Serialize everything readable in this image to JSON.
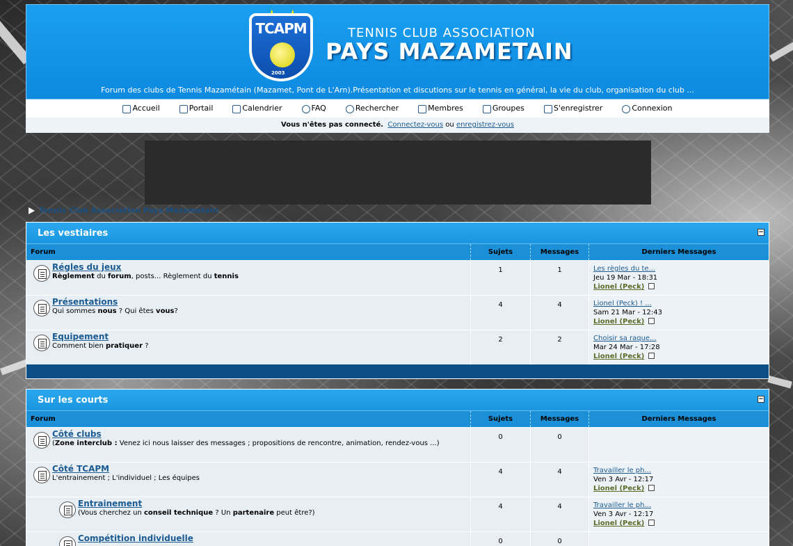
{
  "header": {
    "logo_text": "TCAPM",
    "logo_year": "2003",
    "site_sub": "TENNIS CLUB ASSOCIATION",
    "site_main": "PAYS MAZAMETAIN",
    "description": "Forum des clubs de Tennis Mazamétain (Mazamet, Pont de L'Arn).Présentation et discutions sur le tennis en général, la vie du club, organisation du club ..."
  },
  "nav": {
    "items": [
      {
        "label": "Accueil",
        "icon": "home-icon"
      },
      {
        "label": "Portail",
        "icon": "portal-icon"
      },
      {
        "label": "Calendrier",
        "icon": "calendar-icon"
      },
      {
        "label": "FAQ",
        "icon": "help-icon"
      },
      {
        "label": "Rechercher",
        "icon": "search-icon"
      },
      {
        "label": "Membres",
        "icon": "members-icon"
      },
      {
        "label": "Groupes",
        "icon": "groups-icon"
      },
      {
        "label": "S'enregistrer",
        "icon": "register-icon"
      },
      {
        "label": "Connexion",
        "icon": "power-icon"
      }
    ]
  },
  "loginbar": {
    "status": "Vous n'êtes pas connecté.",
    "login_link": "Connectez-vous",
    "or": "ou",
    "register_link": "enregistrez-vous"
  },
  "breadcrumb": {
    "label": "Tennis Club Association Pays Mazametain"
  },
  "columns": {
    "forum": "Forum",
    "topics": "Sujets",
    "messages": "Messages",
    "last": "Derniers Messages"
  },
  "categories": [
    {
      "title": "Les vestiaires",
      "toggle": "−",
      "forums": [
        {
          "title": "Régles du jeux",
          "desc_parts": [
            [
              "b",
              "Règlement"
            ],
            [
              "t",
              " du "
            ],
            [
              "b",
              "forum"
            ],
            [
              "t",
              ", posts... Règlement du "
            ],
            [
              "b",
              "tennis"
            ]
          ],
          "topics": "1",
          "messages": "1",
          "last_title": "Les règles du te...",
          "last_date": "Jeu 19 Mar - 18:31",
          "last_author": "Lionel (Peck)"
        },
        {
          "title": "Présentations",
          "desc_parts": [
            [
              "t",
              "Qui sommes "
            ],
            [
              "b",
              "nous"
            ],
            [
              "t",
              " ? Qui êtes "
            ],
            [
              "b",
              "vous"
            ],
            [
              "t",
              "?"
            ]
          ],
          "topics": "4",
          "messages": "4",
          "last_title": "Lionel (Peck) ! ...",
          "last_date": "Sam 21 Mar - 12:43",
          "last_author": "Lionel (Peck)"
        },
        {
          "title": "Equipement",
          "desc_parts": [
            [
              "t",
              "Comment bien "
            ],
            [
              "b",
              "pratiquer"
            ],
            [
              "t",
              " ?"
            ]
          ],
          "topics": "2",
          "messages": "2",
          "last_title": "Choisir sa raque...",
          "last_date": "Mar 24 Mar - 17:28",
          "last_author": "Lionel (Peck)"
        }
      ]
    },
    {
      "title": "Sur les courts",
      "toggle": "−",
      "forums": [
        {
          "title": "Côté clubs",
          "desc_parts": [
            [
              "t",
              "("
            ],
            [
              "b",
              "Zone interclub :"
            ],
            [
              "t",
              " Venez ici nous laisser des messages ; propositions de rencontre, animation, rendez-vous ...)"
            ]
          ],
          "topics": "0",
          "messages": "0",
          "last_title": "",
          "last_date": "",
          "last_author": ""
        },
        {
          "title": "Côté TCAPM",
          "desc_parts": [
            [
              "t",
              "L'entrainement ; L'individuel ; Les équipes"
            ]
          ],
          "topics": "4",
          "messages": "4",
          "last_title": "Travailler le ph...",
          "last_date": "Ven 3 Avr - 12:17",
          "last_author": "Lionel (Peck)"
        },
        {
          "title": "Entrainement",
          "sub": true,
          "desc_parts": [
            [
              "t",
              "(Vous cherchez un "
            ],
            [
              "b",
              "conseil technique"
            ],
            [
              "t",
              " ? Un "
            ],
            [
              "b",
              "partenaire"
            ],
            [
              "t",
              " peut être?)"
            ]
          ],
          "topics": "4",
          "messages": "4",
          "last_title": "Travailler le ph...",
          "last_date": "Ven 3 Avr - 12:17",
          "last_author": "Lionel (Peck)"
        },
        {
          "title": "Compétition individuelle",
          "sub": true,
          "desc_parts": [],
          "topics": "0",
          "messages": "0",
          "last_title": "",
          "last_date": "",
          "last_author": ""
        }
      ]
    }
  ]
}
